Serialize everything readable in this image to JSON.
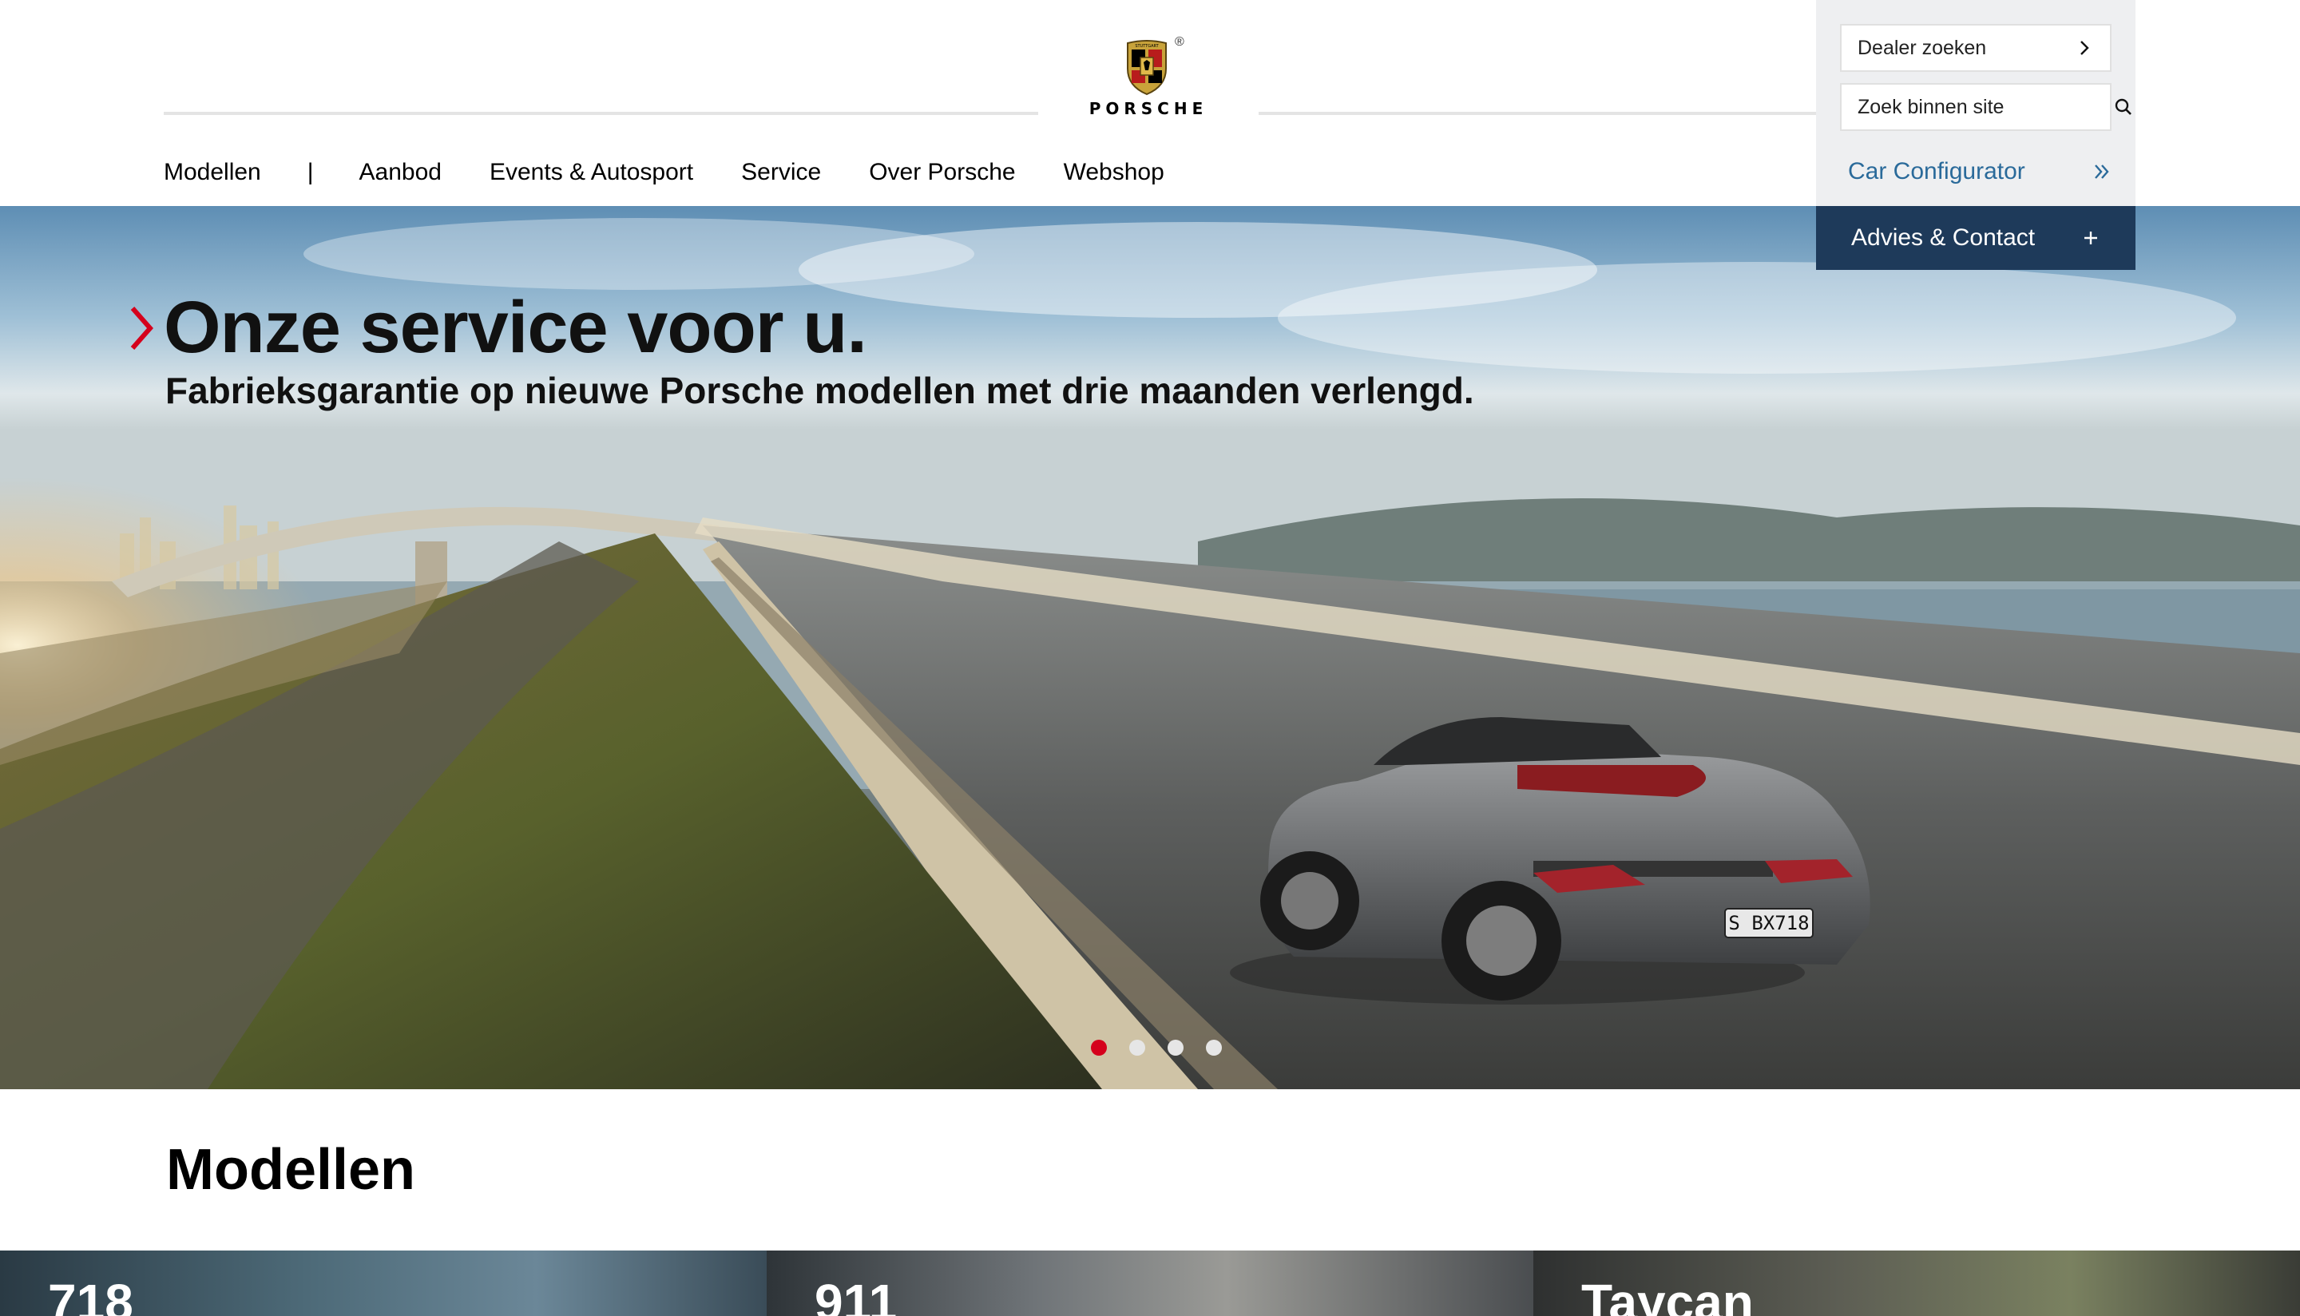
{
  "brand": {
    "wordmark": "PORSCHE",
    "registered": "®",
    "logo_icon": "porsche-crest-icon"
  },
  "nav": {
    "items": [
      {
        "label": "Modellen"
      },
      {
        "label": "Aanbod"
      },
      {
        "label": "Events & Autosport"
      },
      {
        "label": "Service"
      },
      {
        "label": "Over Porsche"
      },
      {
        "label": "Webshop"
      }
    ],
    "separator": "|"
  },
  "utility": {
    "dealer_label": "Dealer zoeken",
    "search_placeholder": "Zoek binnen site",
    "configurator_label": "Car Configurator",
    "advies_label": "Advies & Contact",
    "accent_color": "#2a6a9a",
    "panel_dark_color": "#1e3a5a"
  },
  "hero": {
    "title": "Onze service voor u.",
    "subtitle": "Fabrieksgarantie op nieuwe Porsche modellen met drie maanden verlengd.",
    "license_plate": "S BX718",
    "slides_total": 4,
    "active_slide": 1,
    "accent_color": "#d5001c"
  },
  "models": {
    "title": "Modellen",
    "cards": [
      {
        "label": "718"
      },
      {
        "label": "911"
      },
      {
        "label": "Taycan"
      }
    ]
  }
}
